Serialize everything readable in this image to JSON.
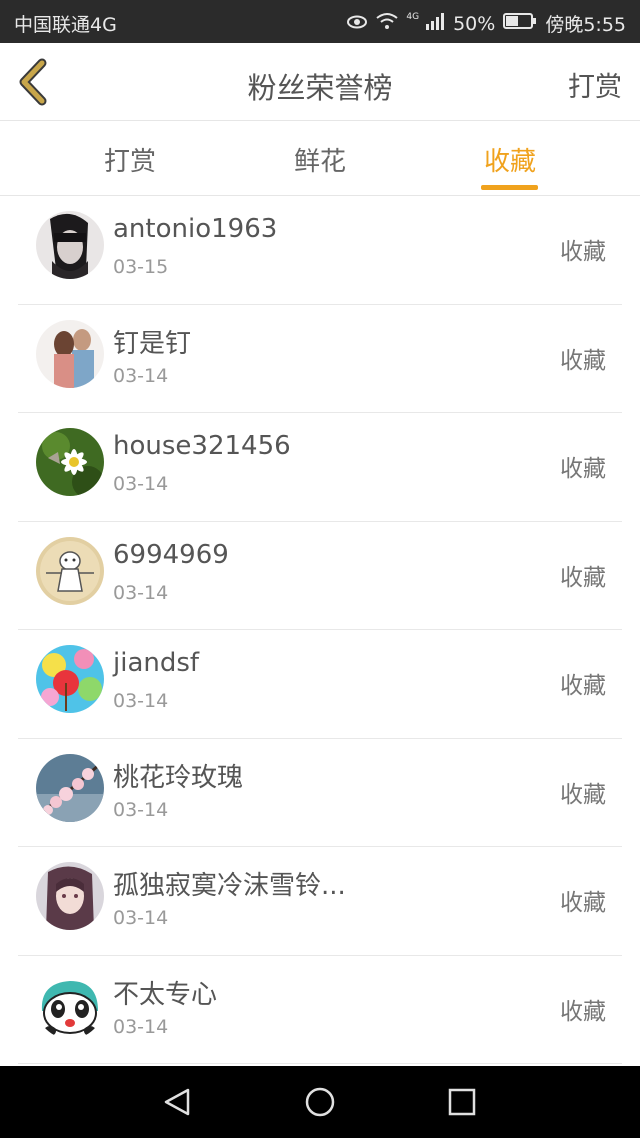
{
  "status_bar": {
    "carrier": "中国联通4G",
    "network_badge": "4G",
    "battery": "50%",
    "time": "傍晚5:55"
  },
  "header": {
    "title": "粉丝荣誉榜",
    "action_label": "打赏"
  },
  "tabs": [
    {
      "label": "打赏",
      "active": false
    },
    {
      "label": "鲜花",
      "active": false
    },
    {
      "label": "收藏",
      "active": true
    }
  ],
  "list": [
    {
      "name": "antonio1963",
      "date": "03-15",
      "tag": "收藏"
    },
    {
      "name": "钉是钉",
      "date": "03-14",
      "tag": "收藏"
    },
    {
      "name": "house321456",
      "date": "03-14",
      "tag": "收藏"
    },
    {
      "name": "6994969",
      "date": "03-14",
      "tag": "收藏"
    },
    {
      "name": "jiandsf",
      "date": "03-14",
      "tag": "收藏"
    },
    {
      "name": "桃花玲玫瑰",
      "date": "03-14",
      "tag": "收藏"
    },
    {
      "name": "孤独寂寞冷沫雪铃...",
      "date": "03-14",
      "tag": "收藏"
    },
    {
      "name": "不太专心",
      "date": "03-14",
      "tag": "收藏"
    }
  ],
  "colors": {
    "accent": "#f0a21d",
    "back_arrow": "#c8a64a"
  }
}
